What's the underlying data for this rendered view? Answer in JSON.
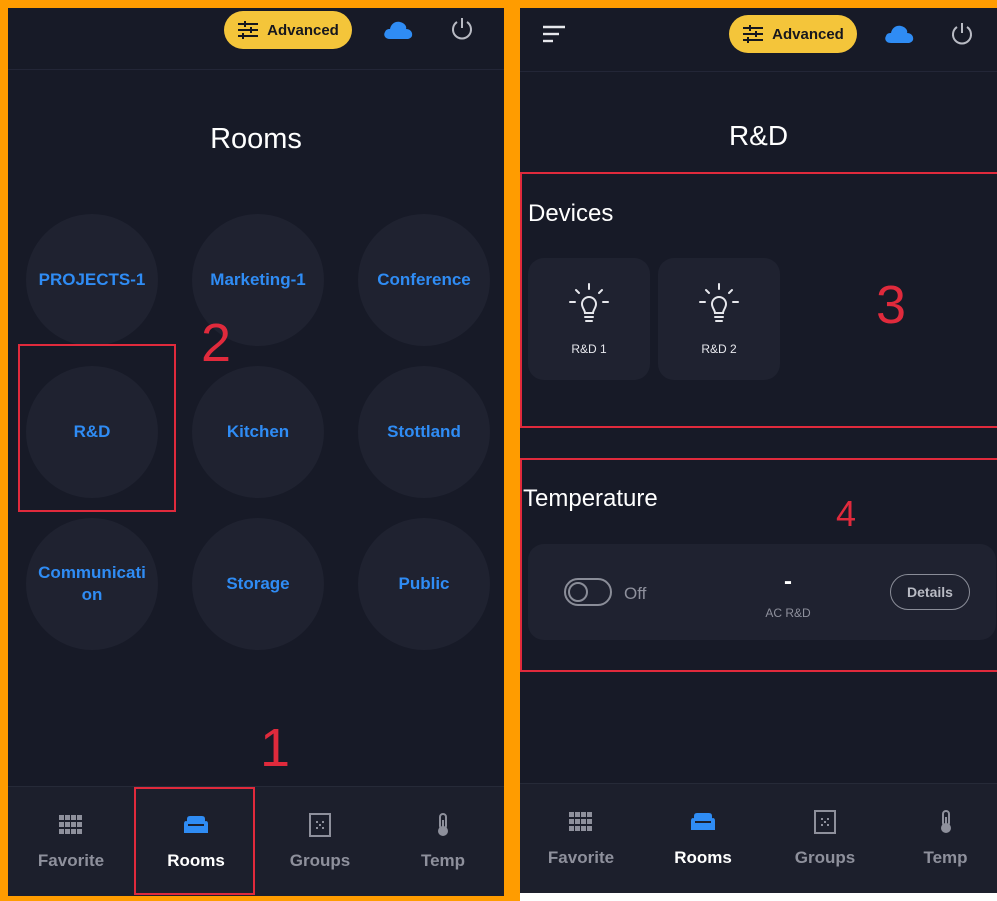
{
  "left_screen": {
    "header": {
      "advanced_label": "Advanced"
    },
    "title": "Rooms",
    "rooms": [
      {
        "name": "PROJECTS-1"
      },
      {
        "name": "Marketing-1"
      },
      {
        "name": "Conference"
      },
      {
        "name": "R&D"
      },
      {
        "name": "Kitchen"
      },
      {
        "name": "Stottland"
      },
      {
        "name": "Communication"
      },
      {
        "name": "Storage"
      },
      {
        "name": "Public"
      }
    ],
    "nav": [
      {
        "label": "Favorite",
        "icon": "grid-icon",
        "active": false
      },
      {
        "label": "Rooms",
        "icon": "sofa-icon",
        "active": true
      },
      {
        "label": "Groups",
        "icon": "groups-icon",
        "active": false
      },
      {
        "label": "Temp",
        "icon": "thermometer-icon",
        "active": false
      }
    ],
    "annotations": [
      "1",
      "2"
    ]
  },
  "right_screen": {
    "header": {
      "advanced_label": "Advanced"
    },
    "title": "R&D",
    "devices_section": {
      "title": "Devices",
      "devices": [
        {
          "name": "R&D 1",
          "icon": "lightbulb-icon"
        },
        {
          "name": "R&D 2",
          "icon": "lightbulb-icon"
        }
      ]
    },
    "temperature_section": {
      "title": "Temperature",
      "toggle_label": "Off",
      "value": "-",
      "device_name": "AC R&D",
      "details_label": "Details"
    },
    "nav": [
      {
        "label": "Favorite",
        "icon": "grid-icon",
        "active": false
      },
      {
        "label": "Rooms",
        "icon": "sofa-icon",
        "active": true
      },
      {
        "label": "Groups",
        "icon": "groups-icon",
        "active": false
      },
      {
        "label": "Temp",
        "icon": "thermometer-icon",
        "active": false
      }
    ],
    "annotations": [
      "3",
      "4"
    ]
  },
  "colors": {
    "frame": "#ff9c00",
    "background": "#171a27",
    "accent_blue": "#2f8cf4",
    "advanced_yellow": "#f4c53a",
    "annotation_red": "#e02a3c"
  }
}
